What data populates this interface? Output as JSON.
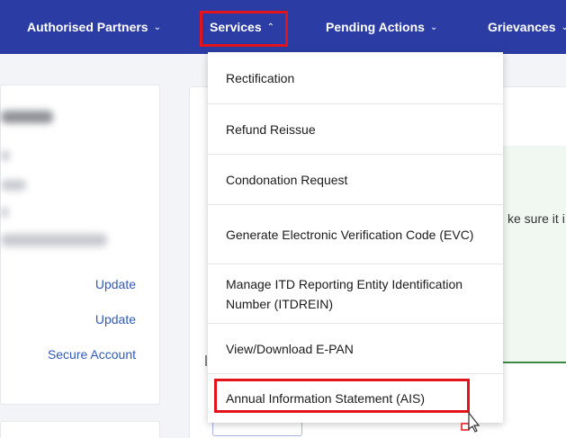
{
  "nav": {
    "authorised_partners": "Authorised Partners",
    "services": "Services",
    "pending_actions": "Pending Actions",
    "grievances": "Grievances",
    "caret_down": "⌄",
    "caret_up": "⌃"
  },
  "left_card": {
    "links": [
      "Update",
      "Update",
      "Secure Account"
    ]
  },
  "background": {
    "partial_text": "ke sure it i"
  },
  "services_menu": {
    "items": [
      "Rectification",
      "Refund Reissue",
      "Condonation Request",
      "Generate Electronic Verification Code (EVC)",
      "Manage ITD Reporting Entity Identification Number (ITDREIN)",
      "View/Download E-PAN",
      "Annual Information Statement (AIS)"
    ]
  },
  "colors": {
    "navbar": "#2b3da4",
    "highlight": "#e3131b",
    "link": "#2f5ab8",
    "green_border": "#3d8b45"
  },
  "icons": {
    "cursor": "pointer-cursor-icon"
  }
}
